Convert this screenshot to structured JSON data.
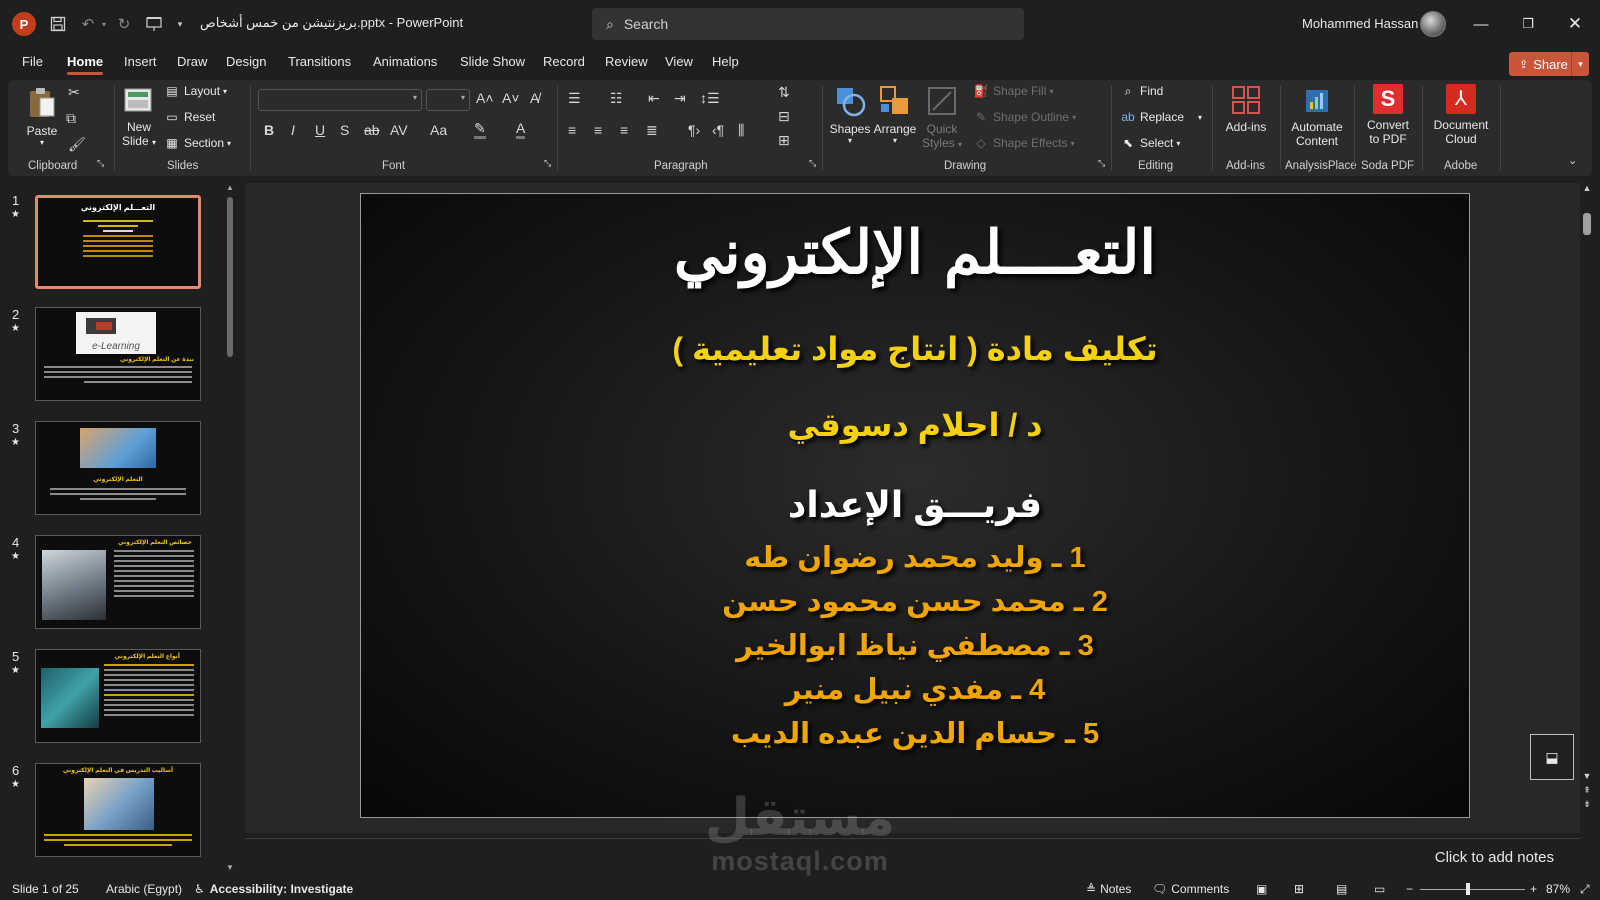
{
  "titlebar": {
    "title": "بريزنتيشن من خمس أشخاص.pptx  -  PowerPoint",
    "search_placeholder": "Search",
    "username": "Mohammed Hassan"
  },
  "menu": {
    "tabs": [
      "File",
      "Home",
      "Insert",
      "Draw",
      "Design",
      "Transitions",
      "Animations",
      "Slide Show",
      "Record",
      "Review",
      "View",
      "Help"
    ],
    "active": "Home",
    "share": "Share"
  },
  "ribbon": {
    "clipboard": {
      "label": "Clipboard",
      "paste": "Paste"
    },
    "slides": {
      "label": "Slides",
      "new_slide_1": "New",
      "new_slide_2": "Slide",
      "layout": "Layout",
      "reset": "Reset",
      "section": "Section"
    },
    "font": {
      "label": "Font"
    },
    "paragraph": {
      "label": "Paragraph"
    },
    "drawing": {
      "label": "Drawing",
      "shapes": "Shapes",
      "arrange": "Arrange",
      "quick_styles_1": "Quick",
      "quick_styles_2": "Styles",
      "shape_fill": "Shape Fill",
      "shape_outline": "Shape Outline",
      "shape_effects": "Shape Effects"
    },
    "editing": {
      "label": "Editing",
      "find": "Find",
      "replace": "Replace",
      "select": "Select"
    },
    "addins": {
      "label": "Add-ins",
      "btn": "Add-ins"
    },
    "analysisplace": {
      "label": "AnalysisPlace",
      "btn1": "Automate",
      "btn2": "Content"
    },
    "sodapdf": {
      "label": "Soda PDF",
      "btn1": "Convert",
      "btn2": "to PDF"
    },
    "adobe": {
      "label": "Adobe",
      "btn1": "Document",
      "btn2": "Cloud"
    }
  },
  "thumbnails": [
    {
      "num": "1",
      "title": "التعـــلم الإلكتروني",
      "selected": true
    },
    {
      "num": "2",
      "title": "نبذة عن التعلم الإلكتروني",
      "image_label": "e-Learning"
    },
    {
      "num": "3",
      "title": "التعلم الإلكتروني"
    },
    {
      "num": "4",
      "title": "خصائص التعلم الإلكتروني"
    },
    {
      "num": "5",
      "title": "أنواع التعلم الإلكتروني"
    },
    {
      "num": "6",
      "title": "أساليب التدريس في التعلم الإلكتروني"
    }
  ],
  "slide": {
    "title": "التعــــلم الإلكتروني",
    "assignment": "تكليف مادة ( انتاج مواد تعليمية )",
    "doctor": "د / احلام دسوقي",
    "team_heading": "فريـــق الإعداد",
    "members": [
      "1 ـ وليد محمد رضوان طه",
      "2 ـ محمد حسن محمود حسن",
      "3 ـ مصطفي نياظ ابوالخير",
      "4 ـ مفدي نبيل منير",
      "5 ـ  حسام الدين عبده الديب"
    ],
    "colors": {
      "title": "#ffffff",
      "subtitle": "#f5d10f",
      "members": "#f0a500"
    }
  },
  "notes": {
    "placeholder": "Click to add notes"
  },
  "watermark": {
    "arabic": "مستقل",
    "latin": "mostaql.com"
  },
  "status": {
    "slide_count": "Slide 1 of 25",
    "language": "Arabic (Egypt)",
    "accessibility": "Accessibility: Investigate",
    "notes": "Notes",
    "comments": "Comments",
    "zoom": "87%"
  }
}
